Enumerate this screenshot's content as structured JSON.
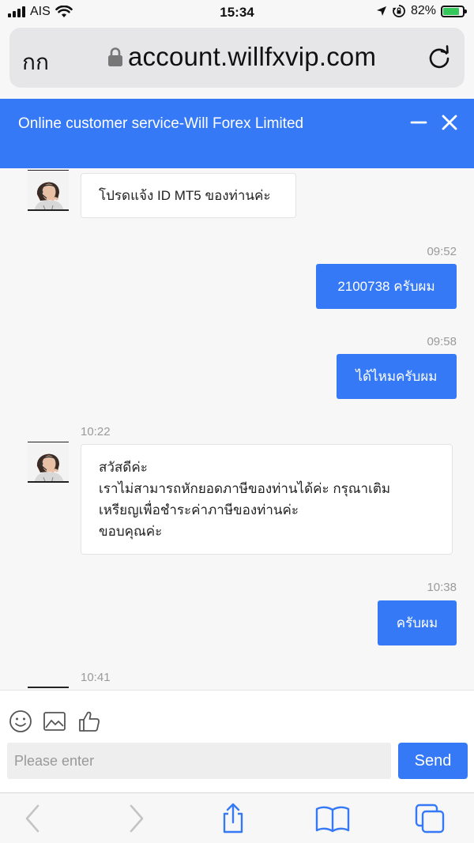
{
  "status_bar": {
    "carrier": "AIS",
    "time": "15:34",
    "battery": "82%",
    "battery_level": 0.82,
    "icons": [
      "signal-icon",
      "wifi-icon",
      "location-icon",
      "orientation-lock-icon",
      "battery-charging-icon"
    ]
  },
  "browser": {
    "text_size_button": "กก",
    "url": "account.willfxvip.com",
    "icons": [
      "lock-icon",
      "reload-icon",
      "back-icon",
      "forward-icon",
      "share-icon",
      "bookmarks-icon",
      "tabs-icon"
    ]
  },
  "chat": {
    "title": "Online customer service-Will Forex Limited",
    "header_icons": [
      "minimize-icon",
      "close-icon"
    ],
    "accent_color": "#3579f6",
    "messages": [
      {
        "from": "agent",
        "text": "โปรดแจ้ง ID MT5 ของท่านค่ะ"
      },
      {
        "from": "user",
        "time": "09:52",
        "text": "2100738 ครับผม"
      },
      {
        "from": "user",
        "time": "09:58",
        "text": "ได้ไหมครับผม"
      },
      {
        "from": "agent",
        "time": "10:22",
        "lines": [
          "สวัสดีค่ะ",
          "เราไม่สามารถหักยอดภาษีของท่านได้ค่ะ กรุณาเติม",
          "เหรียญเพื่อชำระค่าภาษีของท่านค่ะ",
          "ขอบคุณค่ะ"
        ]
      },
      {
        "from": "user",
        "time": "10:38",
        "text": "ครับผม"
      },
      {
        "from": "agent",
        "time": "10:41"
      }
    ]
  },
  "composer": {
    "tool_icons": [
      "emoji-icon",
      "image-icon",
      "thumbs-up-icon"
    ],
    "placeholder": "Please enter",
    "send_label": "Send"
  }
}
